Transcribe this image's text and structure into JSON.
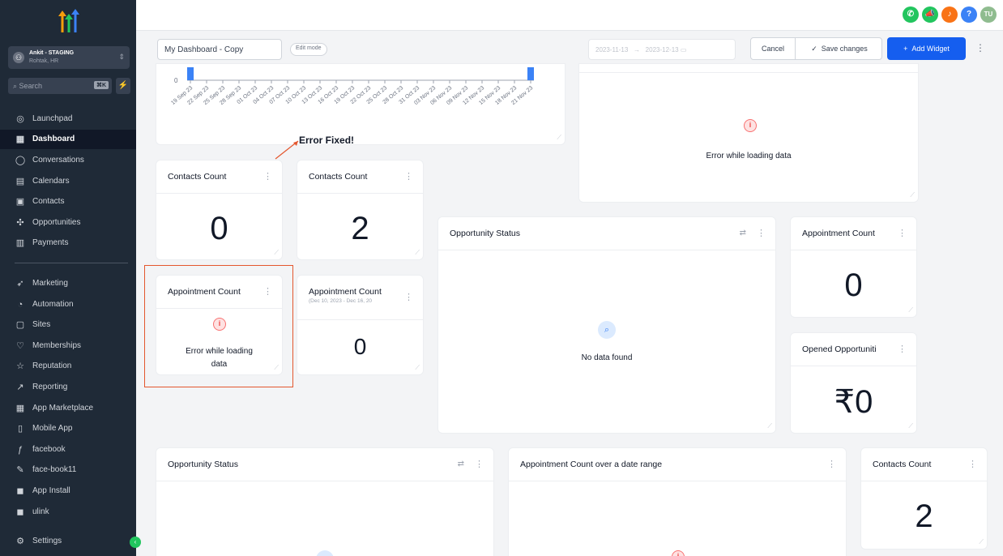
{
  "sidebar": {
    "account": {
      "name": "Ankit - STAGING",
      "location": "Rohtak, HR"
    },
    "search": {
      "placeholder": "Search",
      "shortcut": "⌘K"
    },
    "items": [
      {
        "label": "Launchpad",
        "icon": "rocket-icon"
      },
      {
        "label": "Dashboard",
        "icon": "grid-icon",
        "active": true
      },
      {
        "label": "Conversations",
        "icon": "chat-icon"
      },
      {
        "label": "Calendars",
        "icon": "calendar-icon"
      },
      {
        "label": "Contacts",
        "icon": "contacts-icon"
      },
      {
        "label": "Opportunities",
        "icon": "funnel-icon"
      },
      {
        "label": "Payments",
        "icon": "payments-icon"
      },
      {
        "label": "Marketing",
        "icon": "send-icon"
      },
      {
        "label": "Automation",
        "icon": "automation-icon"
      },
      {
        "label": "Sites",
        "icon": "sites-icon"
      },
      {
        "label": "Memberships",
        "icon": "membership-icon"
      },
      {
        "label": "Reputation",
        "icon": "star-icon"
      },
      {
        "label": "Reporting",
        "icon": "chart-icon"
      },
      {
        "label": "App Marketplace",
        "icon": "grid-icon"
      },
      {
        "label": "Mobile App",
        "icon": "phone-icon"
      },
      {
        "label": "facebook",
        "icon": "facebook-icon"
      },
      {
        "label": "face-book11",
        "icon": "link-icon"
      },
      {
        "label": "App Install",
        "icon": "app-icon"
      },
      {
        "label": "ulink",
        "icon": "app-icon"
      },
      {
        "label": "Settings",
        "icon": "gear-icon"
      }
    ]
  },
  "header": {
    "user_initials": "TU"
  },
  "toolbar": {
    "dashboard_name": "My Dashboard - Copy",
    "edit_mode": "Edit mode",
    "date_start": "2023-11-13",
    "date_sep": "→",
    "date_end": "2023-12-13",
    "cancel": "Cancel",
    "save": "Save changes",
    "add_widget": "Add Widget"
  },
  "chart_data": {
    "type": "bar",
    "title": "",
    "ylabel": "",
    "y_ticks": [
      "0"
    ],
    "categories": [
      "19 Sep 23",
      "22 Sep 23",
      "25 Sep 23",
      "28 Sep 23",
      "01 Oct 23",
      "04 Oct 23",
      "07 Oct 23",
      "10 Oct 23",
      "13 Oct 23",
      "16 Oct 23",
      "19 Oct 23",
      "22 Oct 23",
      "25 Oct 23",
      "28 Oct 23",
      "31 Oct 23",
      "03 Nov 23",
      "06 Nov 23",
      "09 Nov 23",
      "12 Nov 23",
      "15 Nov 23",
      "18 Nov 23",
      "21 Nov 23"
    ],
    "values": [
      1,
      0,
      0,
      0,
      0,
      0,
      0,
      0,
      0,
      0,
      0,
      0,
      0,
      0,
      0,
      0,
      0,
      0,
      0,
      0,
      0,
      1
    ],
    "bar_color": "#3b82f6"
  },
  "annotation": {
    "text": "Error Fixed!"
  },
  "widgets": {
    "error_top_right": {
      "message": "Error while loading data"
    },
    "contacts1": {
      "title": "Contacts Count",
      "value": "0"
    },
    "contacts2": {
      "title": "Contacts Count",
      "value": "2"
    },
    "opp_status": {
      "title": "Opportunity Status",
      "message": "No data found"
    },
    "appt_right": {
      "title": "Appointment Count",
      "value": "0"
    },
    "appt_error": {
      "title": "Appointment Count",
      "message_line1": "Error while loading",
      "message_line2": "data"
    },
    "appt_range": {
      "title": "Appointment Count",
      "subtitle": "(Dec 10, 2023 - Dec 16, 20",
      "value": "0"
    },
    "opened_opps": {
      "title": "Opened Opportuniti",
      "value": "₹0"
    },
    "opp_status2": {
      "title": "Opportunity Status"
    },
    "appt_over_range": {
      "title": "Appointment Count over a date range"
    },
    "contacts3": {
      "title": "Contacts Count",
      "value": "2"
    }
  }
}
